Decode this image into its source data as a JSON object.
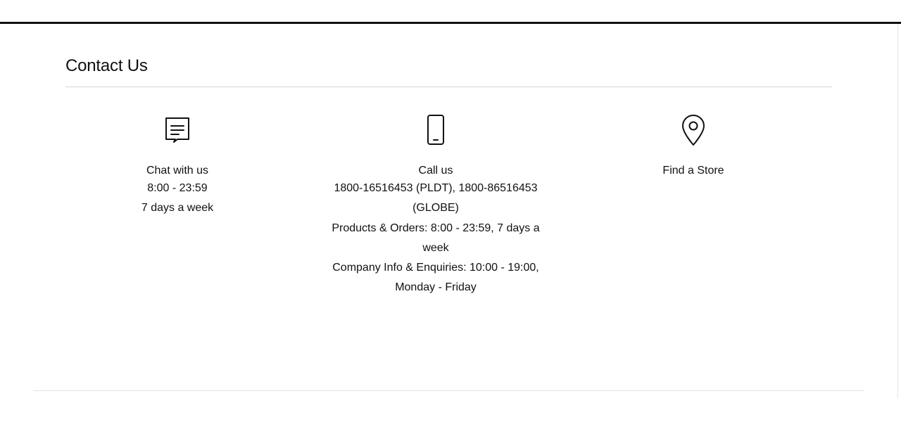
{
  "contact": {
    "title": "Contact Us",
    "chat": {
      "icon": "chat-bubble-icon",
      "title": "Chat with us",
      "lines": [
        "8:00 - 23:59",
        "7 days a week"
      ]
    },
    "call": {
      "icon": "mobile-phone-icon",
      "title": "Call us",
      "lines": [
        "1800-16516453 (PLDT), 1800-86516453 (GLOBE)",
        "Products & Orders: 8:00 - 23:59, 7 days a week",
        "Company Info & Enquiries: 10:00 - 19:00, Monday - Friday"
      ]
    },
    "store": {
      "icon": "location-pin-icon",
      "title": "Find a Store"
    }
  }
}
